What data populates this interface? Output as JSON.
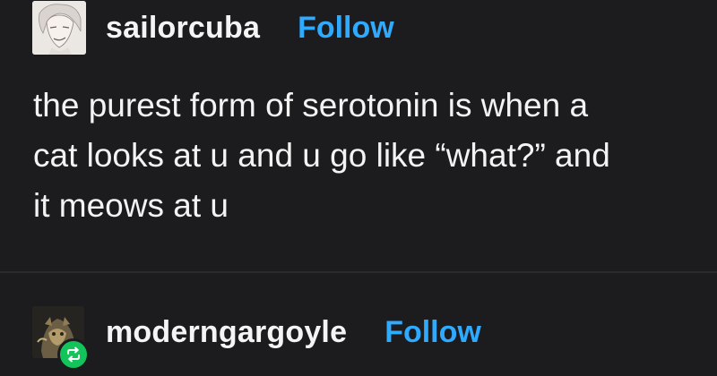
{
  "posts": [
    {
      "username": "sailorcuba",
      "follow_label": "Follow",
      "avatar_icon": "anime-portrait-avatar",
      "body_lines": [
        "the purest form of serotonin is when a",
        "cat looks at u and u go like “what?” and",
        "it meows at u"
      ]
    },
    {
      "username": "moderngargoyle",
      "follow_label": "Follow",
      "avatar_icon": "gargoyle-avatar",
      "badge_icon": "reblog-icon"
    }
  ],
  "colors": {
    "background": "#1c1c1e",
    "text": "#f3f3f3",
    "follow": "#2eaaff",
    "reblog_badge": "#12c45a"
  }
}
